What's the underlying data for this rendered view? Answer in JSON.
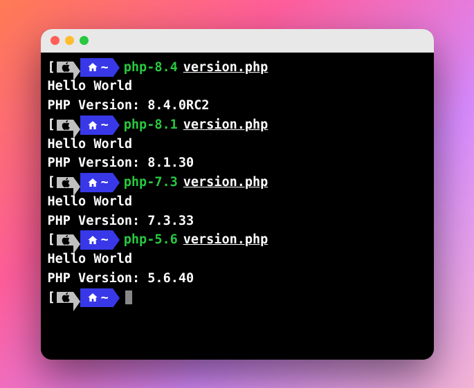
{
  "prompt": {
    "tilde": "~"
  },
  "runs": [
    {
      "cmd": "php-8.4",
      "arg": "version.php",
      "out1": "Hello World",
      "out2": "PHP Version: 8.4.0RC2"
    },
    {
      "cmd": "php-8.1",
      "arg": "version.php",
      "out1": "Hello World",
      "out2": "PHP Version: 8.1.30"
    },
    {
      "cmd": "php-7.3",
      "arg": "version.php",
      "out1": "Hello World",
      "out2": "PHP Version: 7.3.33"
    },
    {
      "cmd": "php-5.6",
      "arg": "version.php",
      "out1": "Hello World",
      "out2": "PHP Version: 5.6.40"
    }
  ]
}
